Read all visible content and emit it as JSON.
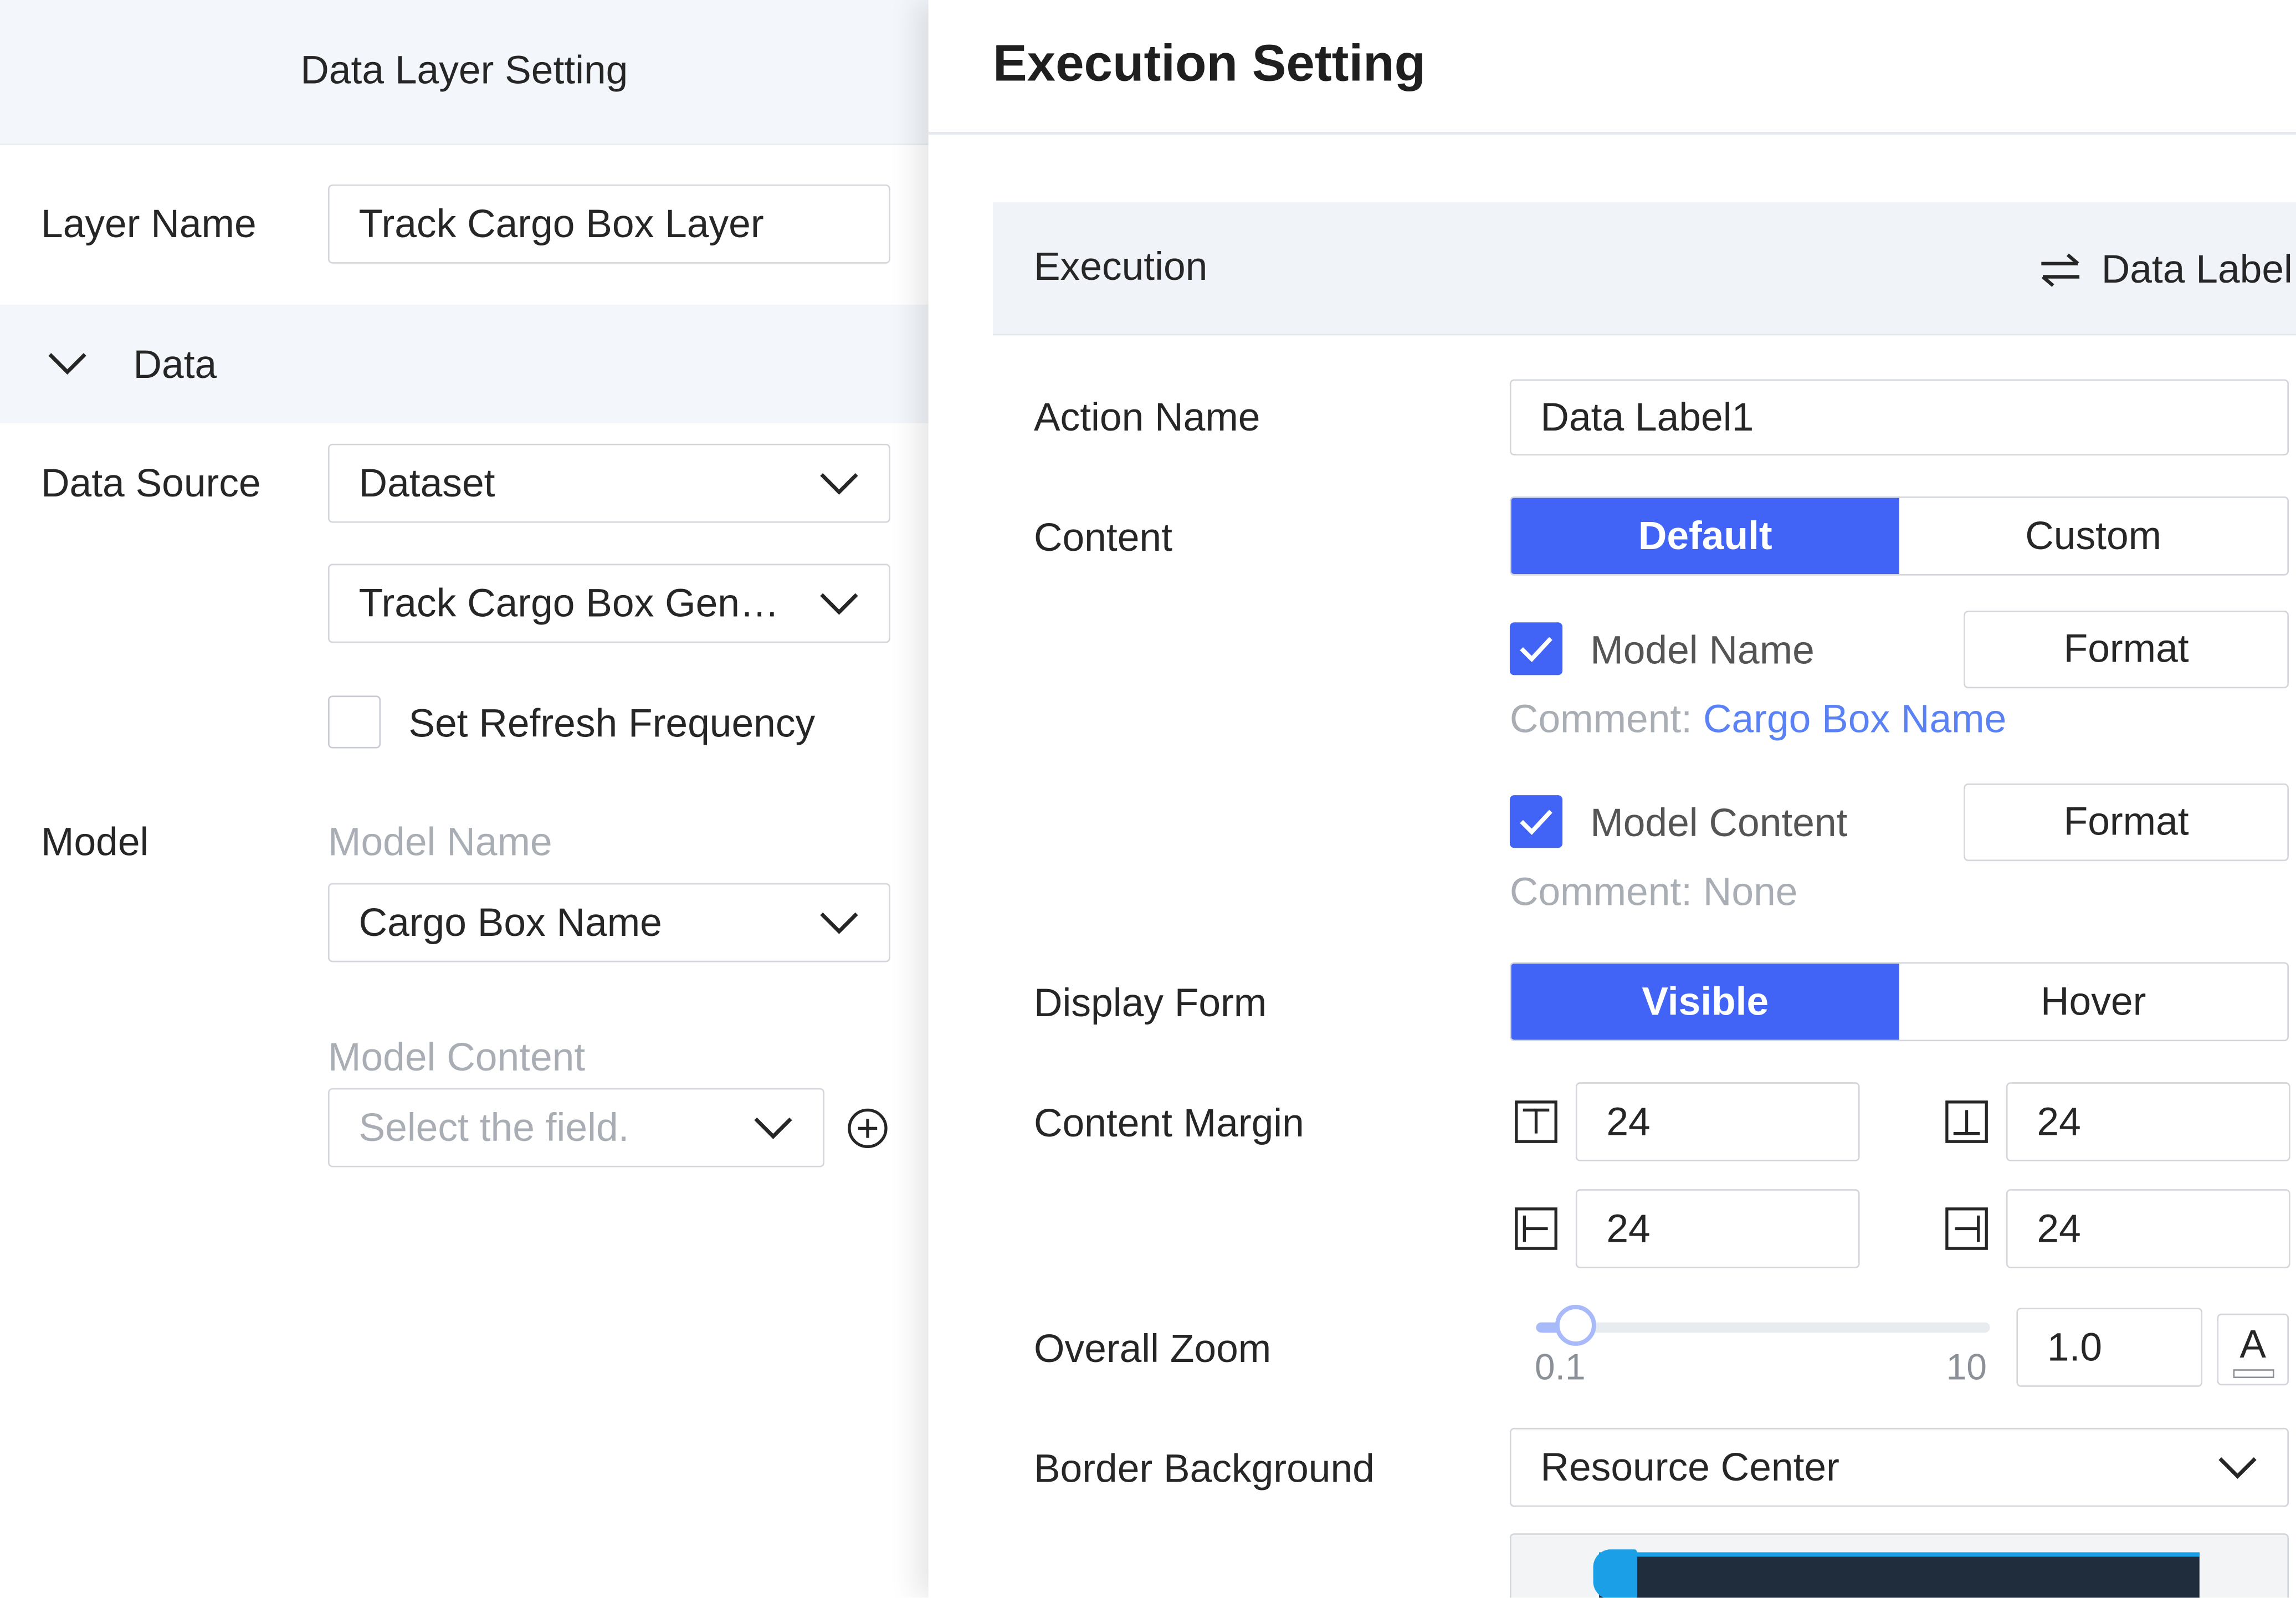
{
  "left_panel": {
    "title": "Data Layer Setting",
    "layer_name_label": "Layer Name",
    "layer_name_value": "Track Cargo Box Layer",
    "data_section_label": "Data",
    "data_source_label": "Data Source",
    "data_source_value": "Dataset",
    "dataset_value": "Track Cargo Box Gen…",
    "refresh_label": "Set Refresh Frequency",
    "refresh_checked": false,
    "model_label": "Model",
    "model_name_label": "Model Name",
    "model_name_value": "Cargo Box Name",
    "model_content_label": "Model Content",
    "model_content_placeholder": "Select the field."
  },
  "drawer": {
    "title": "Execution Setting",
    "execution_label": "Execution",
    "data_label_link": "Data Label",
    "action_name_label": "Action Name",
    "action_name_value": "Data Label1",
    "content_label": "Content",
    "content_options": [
      "Default",
      "Custom"
    ],
    "content_selected": "Default",
    "model_name_check": "Model Name",
    "model_name_checked": true,
    "format_label": "Format",
    "comment_prefix": "Comment:",
    "comment_model_name": "Cargo Box Name",
    "model_content_check": "Model Content",
    "model_content_checked": true,
    "comment_model_content": "Comment: None",
    "display_form_label": "Display Form",
    "display_form_options": [
      "Visible",
      "Hover"
    ],
    "display_form_selected": "Visible",
    "content_margin_label": "Content Margin",
    "margin_top": "24",
    "margin_bottom": "24",
    "margin_left": "24",
    "margin_right": "24",
    "overall_zoom_label": "Overall Zoom",
    "zoom_min": "0.1",
    "zoom_max": "10",
    "zoom_value": "1.0",
    "zoom_font_button": "A",
    "border_background_label": "Border Background",
    "border_background_value": "Resource Center"
  },
  "colors": {
    "accent": "#4164f7",
    "link": "#5a82f5",
    "panel_bg": "#f3f6fa"
  }
}
